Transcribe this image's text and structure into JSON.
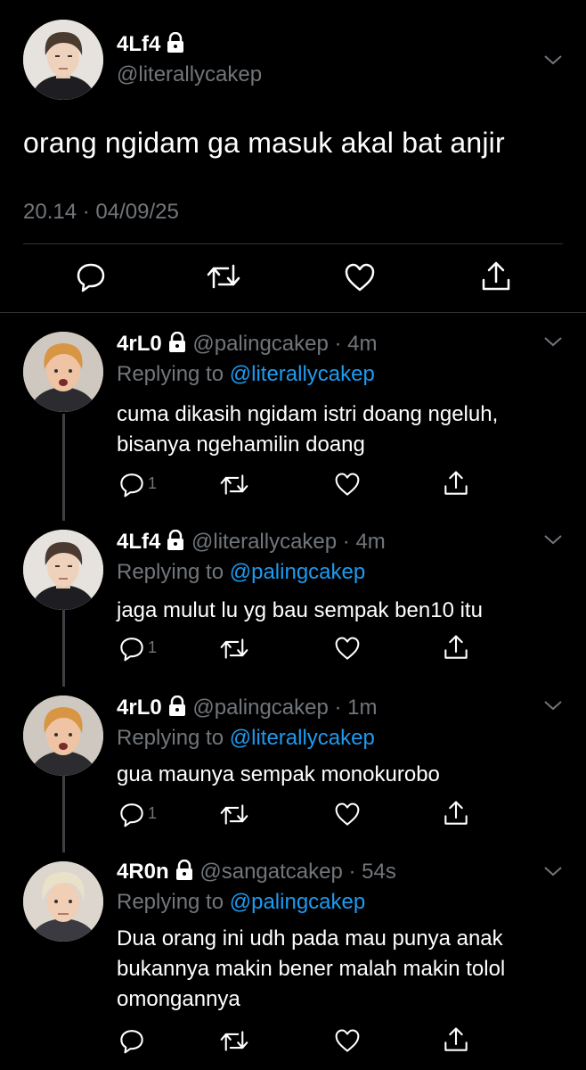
{
  "main_tweet": {
    "name": "4Lf4",
    "handle": "@literallycakep",
    "text": "orang ngidam ga masuk akal bat anjir",
    "timestamp": "20.14 · 04/09/25",
    "actions": [
      "reply-icon",
      "retweet-icon",
      "like-icon",
      "share-icon"
    ]
  },
  "replies": [
    {
      "name": "4rL0",
      "handle": "@palingcakep",
      "time": "· 4m",
      "replying_prefix": "Replying to",
      "replying_to": "@literallycakep",
      "lines": [
        "cuma dikasih ngidam istri doang ngeluh,",
        "bisanya ngehamilin doang"
      ],
      "reply_count": "1"
    },
    {
      "name": "4Lf4",
      "handle": "@literallycakep",
      "time": "· 4m",
      "replying_prefix": "Replying to",
      "replying_to": "@palingcakep",
      "lines": [
        "jaga mulut lu yg bau sempak ben10 itu"
      ],
      "reply_count": "1"
    },
    {
      "name": "4rL0",
      "handle": "@palingcakep",
      "time": "· 1m",
      "replying_prefix": "Replying to",
      "replying_to": "@literallycakep",
      "lines": [
        "gua maunya sempak monokurobo"
      ],
      "reply_count": "1"
    },
    {
      "name": "4R0n",
      "handle": "@sangatcakep",
      "time": "· 54s",
      "replying_prefix": "Replying to",
      "replying_to": "@palingcakep",
      "lines": [
        "Dua orang ini udh pada mau punya anak",
        "bukannya makin bener malah makin tolol",
        "omongannya"
      ],
      "reply_count": ""
    }
  ],
  "colors": {
    "background": "#000000",
    "text": "#ffffff",
    "muted": "#71767b",
    "link": "#1d9bf0",
    "divider": "#2f3336"
  }
}
